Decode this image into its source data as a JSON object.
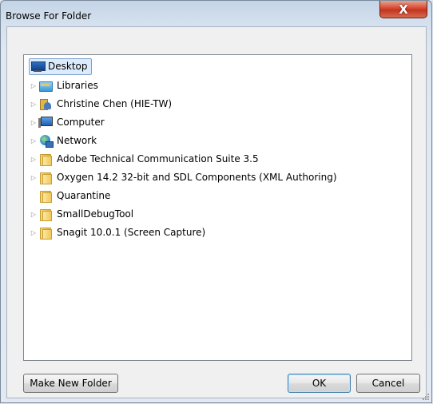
{
  "window": {
    "title": "Browse For Folder",
    "close_label": "X"
  },
  "tree": {
    "items": [
      {
        "label": "Desktop",
        "icon": "desktop-icon",
        "expander": "",
        "selected": true
      },
      {
        "label": "Libraries",
        "icon": "libraries-icon",
        "expander": "▷"
      },
      {
        "label": "Christine Chen (HIE-TW)",
        "icon": "user-folder-icon",
        "expander": "▷"
      },
      {
        "label": "Computer",
        "icon": "computer-icon",
        "expander": "▷"
      },
      {
        "label": "Network",
        "icon": "network-icon",
        "expander": "▷"
      },
      {
        "label": "Adobe Technical Communication Suite 3.5",
        "icon": "folder-icon",
        "expander": "▷"
      },
      {
        "label": "Oxygen 14.2 32-bit and SDL Components (XML Authoring)",
        "icon": "folder-icon",
        "expander": "▷"
      },
      {
        "label": "Quarantine",
        "icon": "folder-icon",
        "expander": ""
      },
      {
        "label": "SmallDebugTool",
        "icon": "folder-icon",
        "expander": "▷"
      },
      {
        "label": "Snagit 10.0.1 (Screen Capture)",
        "icon": "folder-icon",
        "expander": "▷"
      }
    ]
  },
  "buttons": {
    "make_new_folder": "Make New Folder",
    "ok": "OK",
    "cancel": "Cancel"
  }
}
